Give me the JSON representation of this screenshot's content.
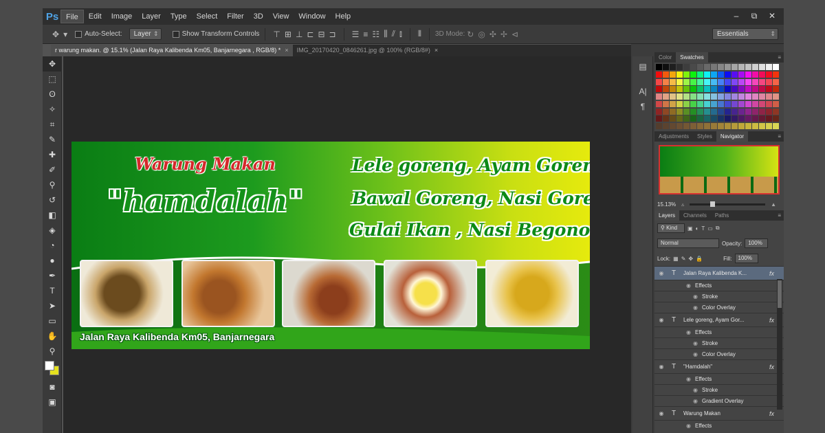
{
  "app": {
    "logo": "Ps"
  },
  "menu": [
    "File",
    "Edit",
    "Image",
    "Layer",
    "Type",
    "Select",
    "Filter",
    "3D",
    "View",
    "Window",
    "Help"
  ],
  "window_controls": [
    "–",
    "⧉",
    "✕"
  ],
  "options_bar": {
    "auto_select_label": "Auto-Select:",
    "auto_select_value": "Layer",
    "transform_label": "Show Transform Controls",
    "mode_3d_label": "3D Mode:",
    "workspace": "Essentials"
  },
  "tabs": [
    {
      "label": "r warung makan. @ 15.1% (Jalan Raya Kalibenda Km05, Banjarnegara , RGB/8) *",
      "active": true
    },
    {
      "label": "IMG_20170420_0846261.jpg @ 100% (RGB/8#)",
      "active": false
    }
  ],
  "banner": {
    "title_small": "Warung Makan",
    "title_big": "\"hamdalah\"",
    "menu_line1": "Lele goreng, Ayam Goreng",
    "menu_line2": "Bawal Goreng, Nasi Goreng",
    "menu_line3": "Gulai Ikan , Nasi Begono",
    "address": "Jalan Raya Kalibenda Km05, Banjarnegara"
  },
  "panels": {
    "color_tabs": [
      "Color",
      "Swatches"
    ],
    "adjust_tabs": [
      "Adjustments",
      "Styles",
      "Navigator"
    ],
    "zoom": "15.13%",
    "layer_tabs": [
      "Layers",
      "Channels",
      "Paths"
    ],
    "kind_label": "Kind",
    "blend_mode": "Normal",
    "opacity_label": "Opacity:",
    "opacity_value": "100%",
    "lock_label": "Lock:",
    "fill_label": "Fill:",
    "fill_value": "100%"
  },
  "layers": [
    {
      "name": "Jalan Raya Kalibenda K...",
      "selected": true,
      "effects_label": "Effects",
      "effects": [
        "Stroke",
        "Color Overlay"
      ]
    },
    {
      "name": "Lele goreng, Ayam Gor...",
      "selected": false,
      "effects_label": "Effects",
      "effects": [
        "Stroke",
        "Color Overlay"
      ]
    },
    {
      "name": "\"Hamdalah\"",
      "selected": false,
      "effects_label": "Effects",
      "effects": [
        "Stroke",
        "Gradient Overlay"
      ]
    },
    {
      "name": "Warung Makan",
      "selected": false,
      "effects_label": "Effects",
      "effects": []
    }
  ],
  "colors": {
    "accent_selection": "#5b6a7e",
    "banner_green": "#0a7d14",
    "banner_yellow": "#e6ea0d",
    "ps_blue": "#4fa3e6"
  }
}
